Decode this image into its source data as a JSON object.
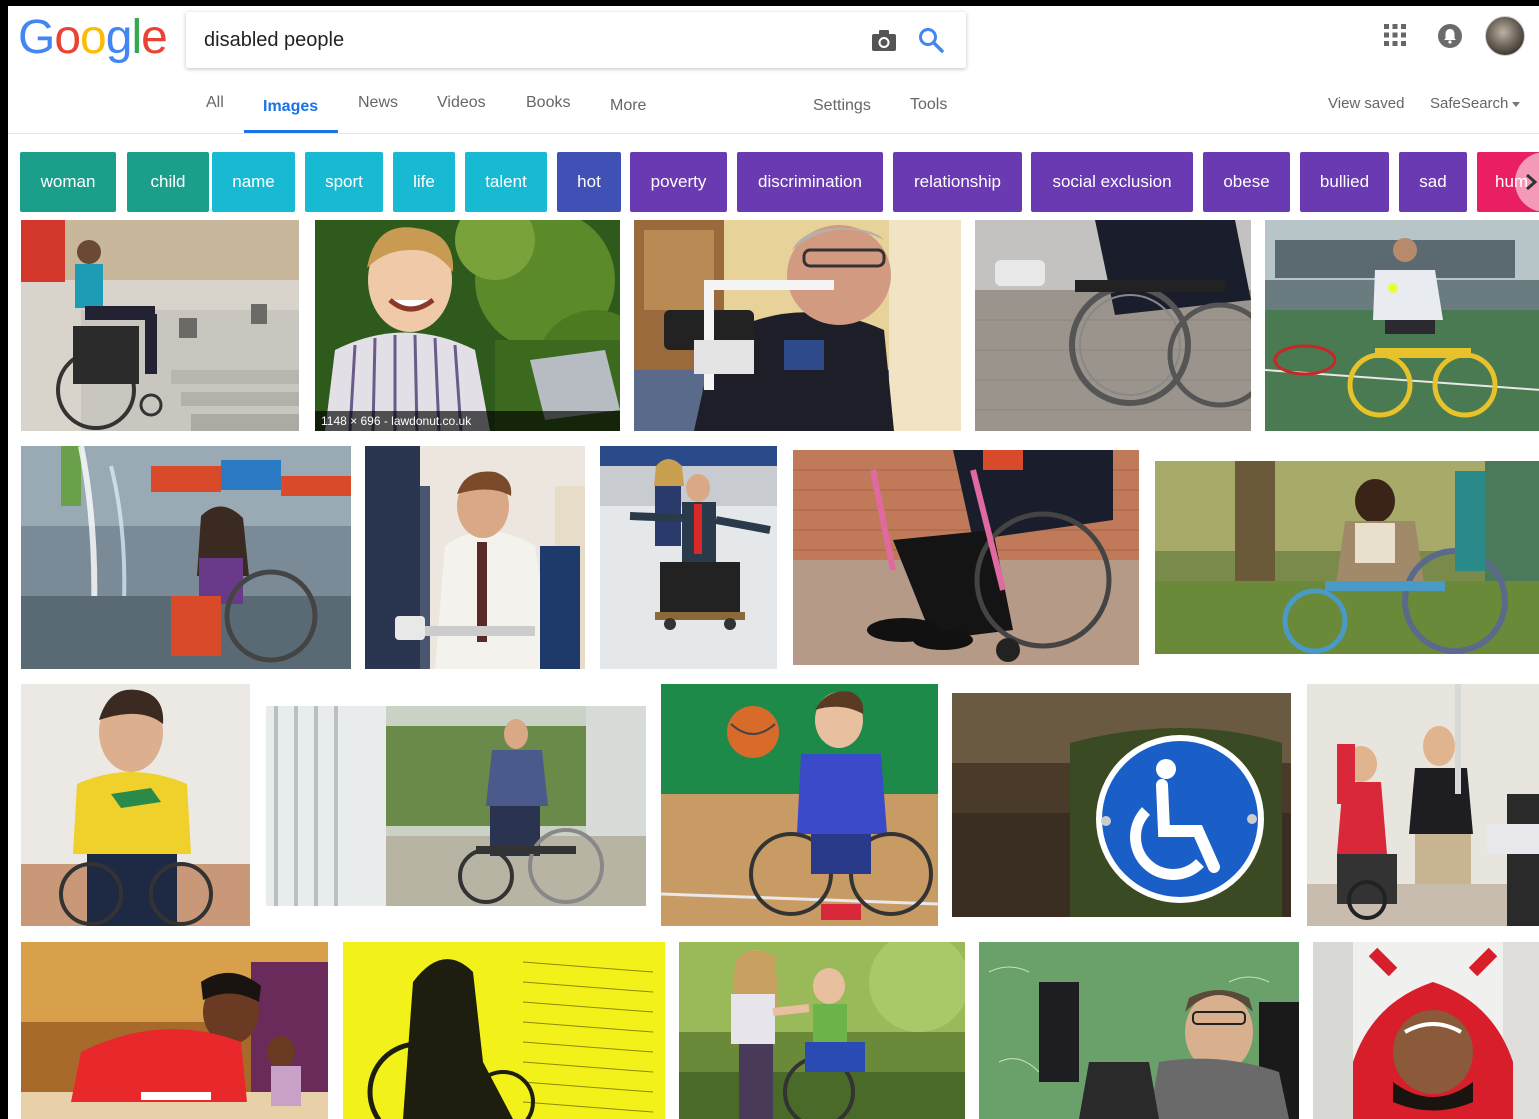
{
  "logo": {
    "letters": [
      "G",
      "o",
      "o",
      "g",
      "l",
      "e"
    ],
    "colors": [
      "#4285F4",
      "#EA4335",
      "#FBBC05",
      "#4285F4",
      "#34A853",
      "#EA4335"
    ]
  },
  "search": {
    "query": "disabled people"
  },
  "icons": {
    "camera": "camera-icon",
    "search": "search-icon",
    "apps": "apps-grid-icon",
    "notifications": "notifications-icon",
    "avatar": "account-avatar"
  },
  "nav": {
    "tabs": [
      "All",
      "Images",
      "News",
      "Videos",
      "Books",
      "More"
    ],
    "active": "Images",
    "settings": "Settings",
    "tools": "Tools",
    "view_saved": "View saved",
    "safesearch": "SafeSearch"
  },
  "chips": [
    {
      "label": "woman",
      "color": "#1b9e8a"
    },
    {
      "label": "child",
      "color": "#1b9e8a"
    },
    {
      "label": "name",
      "color": "#17b9d3"
    },
    {
      "label": "sport",
      "color": "#17b9d3"
    },
    {
      "label": "life",
      "color": "#17b9d3"
    },
    {
      "label": "talent",
      "color": "#17b9d3"
    },
    {
      "label": "hot",
      "color": "#3f51b5"
    },
    {
      "label": "poverty",
      "color": "#6a3ab2"
    },
    {
      "label": "discrimination",
      "color": "#6a3ab2"
    },
    {
      "label": "relationship",
      "color": "#6a3ab2"
    },
    {
      "label": "social exclusion",
      "color": "#6a3ab2"
    },
    {
      "label": "obese",
      "color": "#6a3ab2"
    },
    {
      "label": "bullied",
      "color": "#6a3ab2"
    },
    {
      "label": "sad",
      "color": "#6a3ab2"
    },
    {
      "label": "hum",
      "color": "#e91e63"
    }
  ],
  "results": [
    {
      "name": "man-wheelchair-steps"
    },
    {
      "name": "young-man-laptop",
      "caption": "1148 × 696 - lawdonut.co.uk"
    },
    {
      "name": "man-with-arm-brace"
    },
    {
      "name": "wheelchair-cobblestones"
    },
    {
      "name": "wheelchair-tennis"
    },
    {
      "name": "girl-fountain-wheelchair"
    },
    {
      "name": "man-office-computer"
    },
    {
      "name": "man-ice-skating-wheelchair"
    },
    {
      "name": "pink-wheelchair"
    },
    {
      "name": "boy-blue-wheelchair"
    },
    {
      "name": "man-yellow-shirt"
    },
    {
      "name": "man-phone-wheelchair"
    },
    {
      "name": "boy-basketball"
    },
    {
      "name": "accessibility-sign"
    },
    {
      "name": "man-and-boy-room"
    },
    {
      "name": "man-red-shirt-drawing"
    },
    {
      "name": "yellow-silhouette-forms"
    },
    {
      "name": "girls-park-wheelchair"
    },
    {
      "name": "man-chalkboard-wheelchair"
    },
    {
      "name": "upside-down-man"
    }
  ]
}
